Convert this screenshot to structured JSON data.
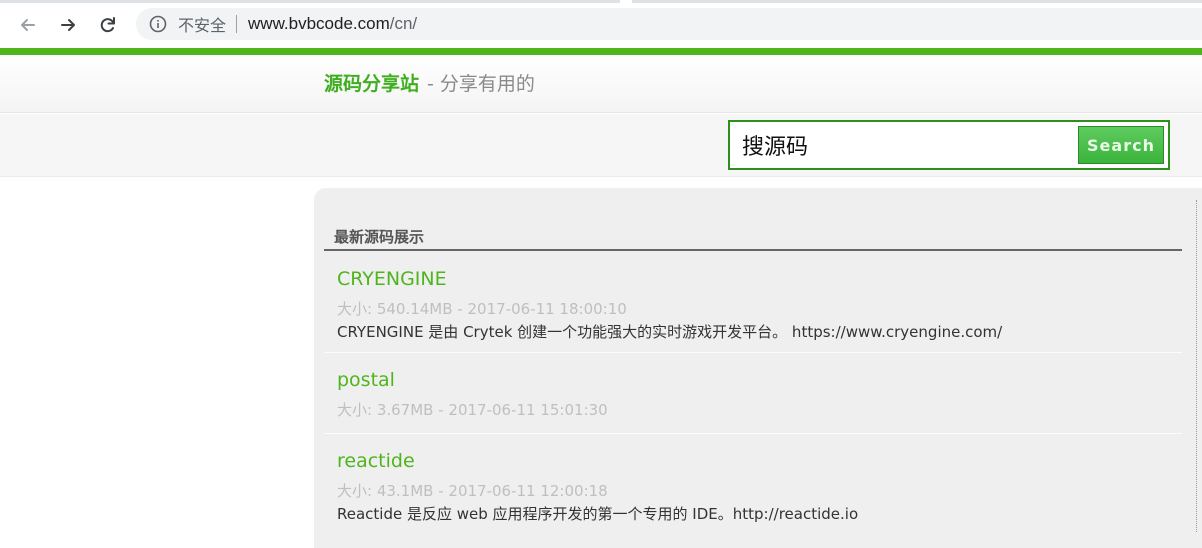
{
  "browser": {
    "security_label": "不安全",
    "url_host": "www.bvbcode.com",
    "url_path": "/cn/"
  },
  "header": {
    "brand_name": "源码分享站",
    "dash": "-",
    "tagline": "分享有用的"
  },
  "search": {
    "value": "搜源码",
    "button_label": "Search"
  },
  "section": {
    "title": "最新源码展示"
  },
  "items": [
    {
      "title": "CRYENGINE",
      "meta": "大小: 540.14MB - 2017-06-11 18:00:10",
      "desc": "CRYENGINE 是由 Crytek 创建一个功能强大的实时游戏开发平台。 https://www.cryengine.com/"
    },
    {
      "title": "postal",
      "meta": "大小: 3.67MB - 2017-06-11 15:01:30",
      "desc": ""
    },
    {
      "title": "reactide",
      "meta": "大小: 43.1MB - 2017-06-11 12:00:18",
      "desc": "Reactide 是反应 web 应用程序开发的第一个专用的 IDE。http://reactide.io"
    }
  ],
  "colors": {
    "brand_green": "#4fb51d",
    "search_border": "#2e8f1a"
  }
}
